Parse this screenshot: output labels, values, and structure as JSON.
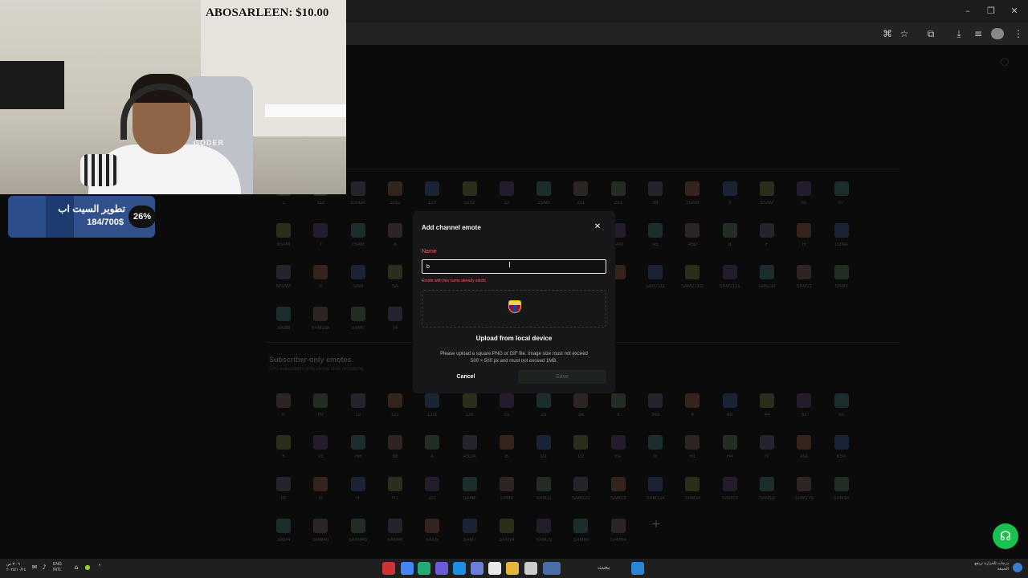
{
  "overlay": {
    "donation": "ABOSARLEEN: $10.00",
    "webcam_label": "GODER",
    "goal": {
      "title": "تطوير السيت اب",
      "amount": "184/700$",
      "percent_label": "26%",
      "progress": 0.26
    }
  },
  "modal": {
    "title": "Add channel emote",
    "name_label": "Name",
    "name_value": "b",
    "error": "Emote with this name already exists",
    "upload_label": "Upload from local device",
    "hint_line1": "Please upload a square PNG or GIF file. Image size must not exceed",
    "hint_line2": "500 × 500 px and must not exceed 1MB.",
    "cancel_label": "Cancel",
    "save_label": "Save"
  },
  "page": {
    "subscriber_title": "Subscriber-only emotes",
    "subscriber_desc": "2/60 subscribers-only emote slots remaining",
    "add_icon": "plus-icon",
    "help_icon": "headset-icon",
    "channel_emote_rows": [
      [
        "1",
        "112",
        "10SDA",
        "1212",
        "123",
        "1232",
        "13",
        "15AM",
        "211",
        "231",
        "38",
        "3SAM",
        "5",
        "5SAM",
        "65",
        "67"
      ],
      [
        "6SAM",
        "7",
        "7SAM",
        "8",
        "",
        "",
        "",
        "",
        "",
        "SAM",
        "A5",
        "A5D",
        "B",
        "F",
        "H",
        "LONA"
      ],
      [
        "MSAM",
        "s",
        "SAM",
        "SA",
        "",
        "",
        "",
        "",
        "",
        "",
        "sam2111",
        "SAM21111",
        "SAM2121",
        "sam232",
        "SAM21",
        "SAM3"
      ],
      [
        "SAM8",
        "SAM93K",
        "SAM0",
        "s4"
      ]
    ],
    "subscriber_emote_rows": [
      [
        "0",
        "09",
        "12",
        "121",
        "1211",
        "128",
        "21",
        "23",
        "3w",
        "3",
        "343",
        "4",
        "43",
        "44",
        "53",
        "55"
      ],
      [
        "6",
        "73",
        "758",
        "88",
        "A",
        "ASDA",
        "B",
        "D1",
        "D2",
        "FA",
        "G",
        "H1",
        "H4",
        "IV",
        "ksa",
        "KSA"
      ],
      [
        "lol",
        "m",
        "R",
        "R1",
        "s21",
        "SA4M",
        "SAM0",
        "SAM11",
        "SAM122",
        "SAM13",
        "SAM134",
        "SAM14",
        "SAM15",
        "SAM18",
        "SAM178",
        "SAM16"
      ],
      [
        "SAM4",
        "SAM40",
        "SAM445",
        "SAM46",
        "SAM5",
        "SAM7",
        "SAM74",
        "SAM75",
        "SAM83",
        "SAM94"
      ]
    ]
  },
  "taskbar": {
    "date_line1": "٣:٠٩ ص",
    "date_line2": "٢٠٢٥/١٠/٢٤",
    "lang_line1": "ENG",
    "lang_line2": "INTL",
    "search_label": "بحث",
    "weather_line1": "درجات الحرارة ترتفع",
    "weather_line2": "الجمعة"
  },
  "colors": {
    "accent_green": "#19c24f",
    "error_red": "#ff5a5a",
    "goal_blue": "#31508c"
  }
}
